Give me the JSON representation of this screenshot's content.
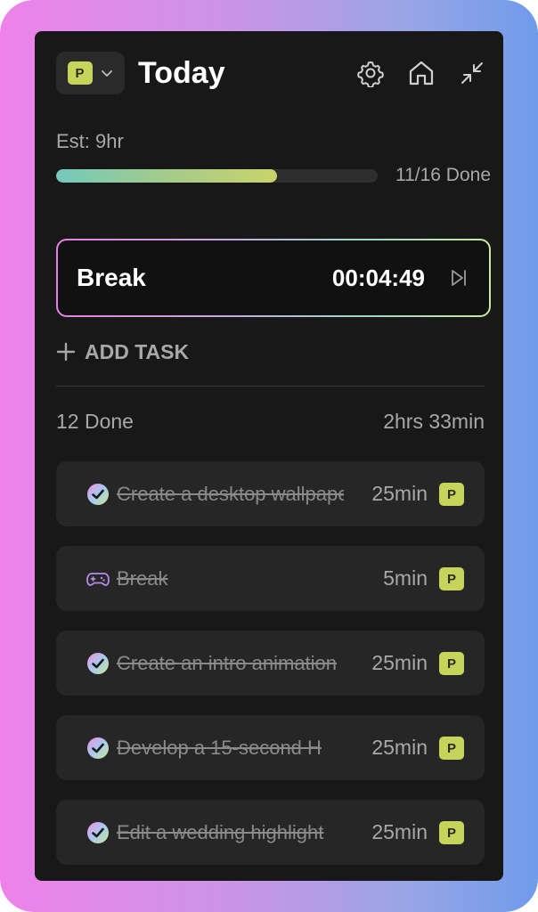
{
  "header": {
    "project_badge": "P",
    "title": "Today",
    "icons": [
      "settings-icon",
      "home-icon",
      "collapse-icon"
    ]
  },
  "summary": {
    "estimate": "Est: 9hr",
    "progress_fraction": 0.687,
    "progress_text": "11/16 Done"
  },
  "timer": {
    "label": "Break",
    "time": "00:04:49"
  },
  "add_task_label": "ADD TASK",
  "done_section": {
    "label": "12 Done",
    "total": "2hrs 33min"
  },
  "tasks": [
    {
      "name": "Create a desktop wallpaper",
      "duration": "25min",
      "badge": "P",
      "icon": "check-circle-icon"
    },
    {
      "name": "Break",
      "duration": "5min",
      "badge": "P",
      "icon": "gamepad-icon"
    },
    {
      "name": "Create an intro animation",
      "duration": "25min",
      "badge": "P",
      "icon": "check-circle-icon"
    },
    {
      "name": "Develop a 15-second H",
      "duration": "25min",
      "badge": "P",
      "icon": "check-circle-icon"
    },
    {
      "name": "Edit a wedding highlight",
      "duration": "25min",
      "badge": "P",
      "icon": "check-circle-icon"
    }
  ],
  "colors": {
    "badge": "#c6d45a",
    "panel": "#181818",
    "card": "#262626"
  }
}
